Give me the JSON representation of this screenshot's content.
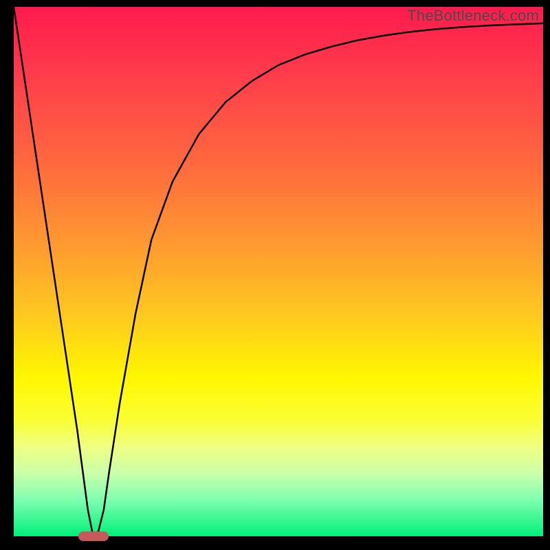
{
  "watermark": "TheBottleneck.com",
  "chart_data": {
    "type": "line",
    "title": "",
    "xlabel": "",
    "ylabel": "",
    "xlim": [
      0,
      100
    ],
    "ylim": [
      0,
      100
    ],
    "x": [
      0,
      3,
      6,
      9,
      12,
      14,
      15,
      16,
      17,
      18,
      20,
      23,
      26,
      30,
      35,
      40,
      45,
      50,
      55,
      60,
      65,
      70,
      75,
      80,
      85,
      90,
      95,
      100
    ],
    "values": [
      100,
      80,
      60,
      40,
      20,
      5,
      0,
      1,
      5,
      12,
      25,
      42,
      56,
      67,
      76,
      82,
      86,
      89,
      91,
      92.5,
      93.7,
      94.6,
      95.3,
      95.8,
      96.2,
      96.5,
      96.7,
      96.9
    ],
    "marker": {
      "x": 15,
      "y": 0
    }
  },
  "colors": {
    "curve": "#000000",
    "marker": "#c65a5a",
    "frame": "#000000"
  }
}
